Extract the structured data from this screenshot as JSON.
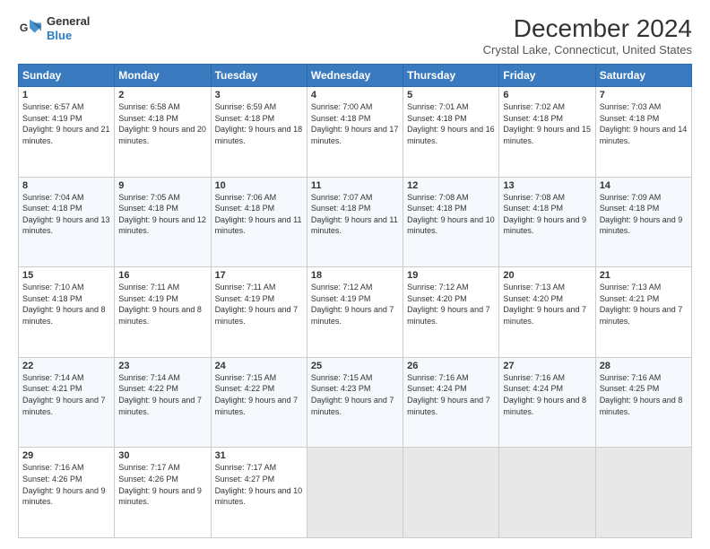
{
  "logo": {
    "general": "General",
    "blue": "Blue"
  },
  "header": {
    "title": "December 2024",
    "subtitle": "Crystal Lake, Connecticut, United States"
  },
  "weekdays": [
    "Sunday",
    "Monday",
    "Tuesday",
    "Wednesday",
    "Thursday",
    "Friday",
    "Saturday"
  ],
  "weeks": [
    [
      {
        "day": "1",
        "sunrise": "6:57 AM",
        "sunset": "4:19 PM",
        "daylight": "9 hours and 21 minutes."
      },
      {
        "day": "2",
        "sunrise": "6:58 AM",
        "sunset": "4:18 PM",
        "daylight": "9 hours and 20 minutes."
      },
      {
        "day": "3",
        "sunrise": "6:59 AM",
        "sunset": "4:18 PM",
        "daylight": "9 hours and 18 minutes."
      },
      {
        "day": "4",
        "sunrise": "7:00 AM",
        "sunset": "4:18 PM",
        "daylight": "9 hours and 17 minutes."
      },
      {
        "day": "5",
        "sunrise": "7:01 AM",
        "sunset": "4:18 PM",
        "daylight": "9 hours and 16 minutes."
      },
      {
        "day": "6",
        "sunrise": "7:02 AM",
        "sunset": "4:18 PM",
        "daylight": "9 hours and 15 minutes."
      },
      {
        "day": "7",
        "sunrise": "7:03 AM",
        "sunset": "4:18 PM",
        "daylight": "9 hours and 14 minutes."
      }
    ],
    [
      {
        "day": "8",
        "sunrise": "7:04 AM",
        "sunset": "4:18 PM",
        "daylight": "9 hours and 13 minutes."
      },
      {
        "day": "9",
        "sunrise": "7:05 AM",
        "sunset": "4:18 PM",
        "daylight": "9 hours and 12 minutes."
      },
      {
        "day": "10",
        "sunrise": "7:06 AM",
        "sunset": "4:18 PM",
        "daylight": "9 hours and 11 minutes."
      },
      {
        "day": "11",
        "sunrise": "7:07 AM",
        "sunset": "4:18 PM",
        "daylight": "9 hours and 11 minutes."
      },
      {
        "day": "12",
        "sunrise": "7:08 AM",
        "sunset": "4:18 PM",
        "daylight": "9 hours and 10 minutes."
      },
      {
        "day": "13",
        "sunrise": "7:08 AM",
        "sunset": "4:18 PM",
        "daylight": "9 hours and 9 minutes."
      },
      {
        "day": "14",
        "sunrise": "7:09 AM",
        "sunset": "4:18 PM",
        "daylight": "9 hours and 9 minutes."
      }
    ],
    [
      {
        "day": "15",
        "sunrise": "7:10 AM",
        "sunset": "4:18 PM",
        "daylight": "9 hours and 8 minutes."
      },
      {
        "day": "16",
        "sunrise": "7:11 AM",
        "sunset": "4:19 PM",
        "daylight": "9 hours and 8 minutes."
      },
      {
        "day": "17",
        "sunrise": "7:11 AM",
        "sunset": "4:19 PM",
        "daylight": "9 hours and 7 minutes."
      },
      {
        "day": "18",
        "sunrise": "7:12 AM",
        "sunset": "4:19 PM",
        "daylight": "9 hours and 7 minutes."
      },
      {
        "day": "19",
        "sunrise": "7:12 AM",
        "sunset": "4:20 PM",
        "daylight": "9 hours and 7 minutes."
      },
      {
        "day": "20",
        "sunrise": "7:13 AM",
        "sunset": "4:20 PM",
        "daylight": "9 hours and 7 minutes."
      },
      {
        "day": "21",
        "sunrise": "7:13 AM",
        "sunset": "4:21 PM",
        "daylight": "9 hours and 7 minutes."
      }
    ],
    [
      {
        "day": "22",
        "sunrise": "7:14 AM",
        "sunset": "4:21 PM",
        "daylight": "9 hours and 7 minutes."
      },
      {
        "day": "23",
        "sunrise": "7:14 AM",
        "sunset": "4:22 PM",
        "daylight": "9 hours and 7 minutes."
      },
      {
        "day": "24",
        "sunrise": "7:15 AM",
        "sunset": "4:22 PM",
        "daylight": "9 hours and 7 minutes."
      },
      {
        "day": "25",
        "sunrise": "7:15 AM",
        "sunset": "4:23 PM",
        "daylight": "9 hours and 7 minutes."
      },
      {
        "day": "26",
        "sunrise": "7:16 AM",
        "sunset": "4:24 PM",
        "daylight": "9 hours and 7 minutes."
      },
      {
        "day": "27",
        "sunrise": "7:16 AM",
        "sunset": "4:24 PM",
        "daylight": "9 hours and 8 minutes."
      },
      {
        "day": "28",
        "sunrise": "7:16 AM",
        "sunset": "4:25 PM",
        "daylight": "9 hours and 8 minutes."
      }
    ],
    [
      {
        "day": "29",
        "sunrise": "7:16 AM",
        "sunset": "4:26 PM",
        "daylight": "9 hours and 9 minutes."
      },
      {
        "day": "30",
        "sunrise": "7:17 AM",
        "sunset": "4:26 PM",
        "daylight": "9 hours and 9 minutes."
      },
      {
        "day": "31",
        "sunrise": "7:17 AM",
        "sunset": "4:27 PM",
        "daylight": "9 hours and 10 minutes."
      },
      null,
      null,
      null,
      null
    ]
  ],
  "labels": {
    "sunrise": "Sunrise:",
    "sunset": "Sunset:",
    "daylight": "Daylight:"
  }
}
